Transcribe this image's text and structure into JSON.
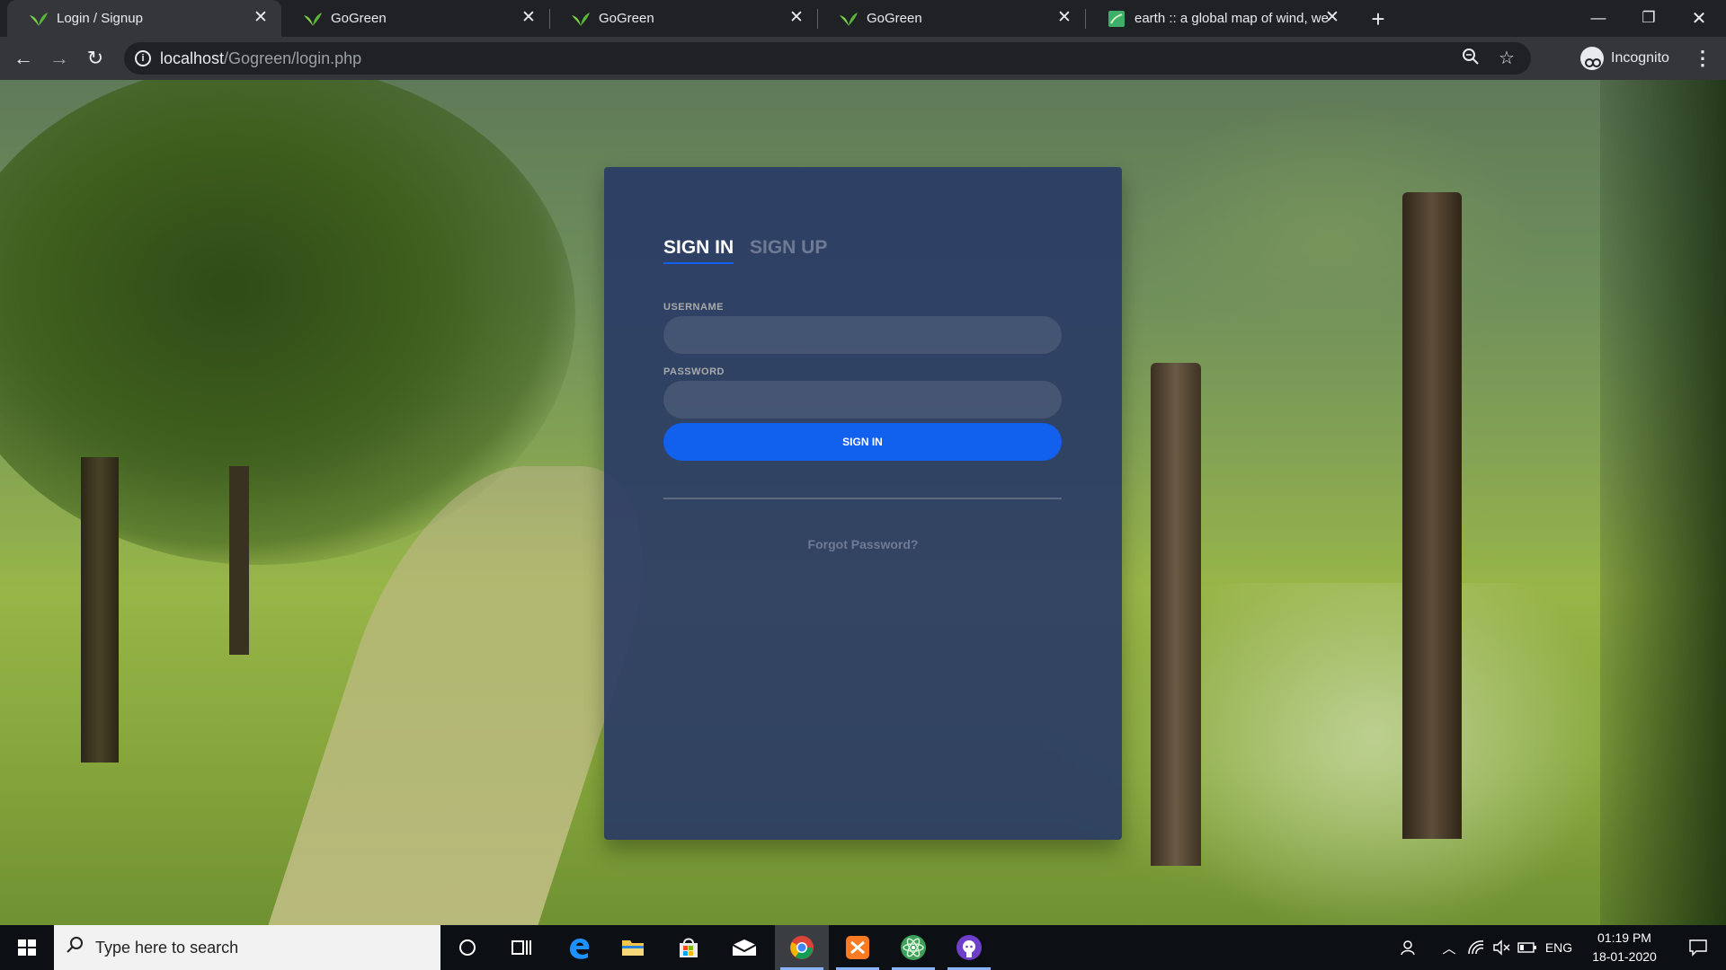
{
  "browser": {
    "tabs": [
      {
        "title": "Login / Signup",
        "active": true
      },
      {
        "title": "GoGreen",
        "active": false
      },
      {
        "title": "GoGreen",
        "active": false
      },
      {
        "title": "GoGreen",
        "active": false
      },
      {
        "title": "earth :: a global map of wind, we",
        "active": false
      }
    ],
    "address": {
      "host": "localhost",
      "path": "/Gogreen/login.php"
    },
    "profile_label": "Incognito",
    "icons": [
      "back-icon",
      "forward-icon",
      "reload-icon",
      "info-icon",
      "zoom-icon",
      "star-icon",
      "incognito-icon",
      "menu-icon",
      "close-icon",
      "new-tab-icon",
      "minimize-icon",
      "restore-icon"
    ]
  },
  "login": {
    "tab_signin": "SIGN IN",
    "tab_signup": "SIGN UP",
    "username_label": "USERNAME",
    "username_value": "",
    "password_label": "PASSWORD",
    "password_value": "",
    "submit_label": "SIGN IN",
    "forgot_link": "Forgot Password?",
    "colors": {
      "accent": "#1161ee",
      "card": "#283965",
      "inactive_text": "#6f7a95"
    }
  },
  "taskbar": {
    "search_placeholder": "Type here to search",
    "language": "ENG",
    "time": "01:19 PM",
    "date": "18-01-2020",
    "apps": [
      "cortana-icon",
      "task-view-icon",
      "edge-icon",
      "file-explorer-icon",
      "store-icon",
      "mail-icon",
      "chrome-icon",
      "xampp-icon",
      "atom-icon",
      "github-icon"
    ]
  }
}
